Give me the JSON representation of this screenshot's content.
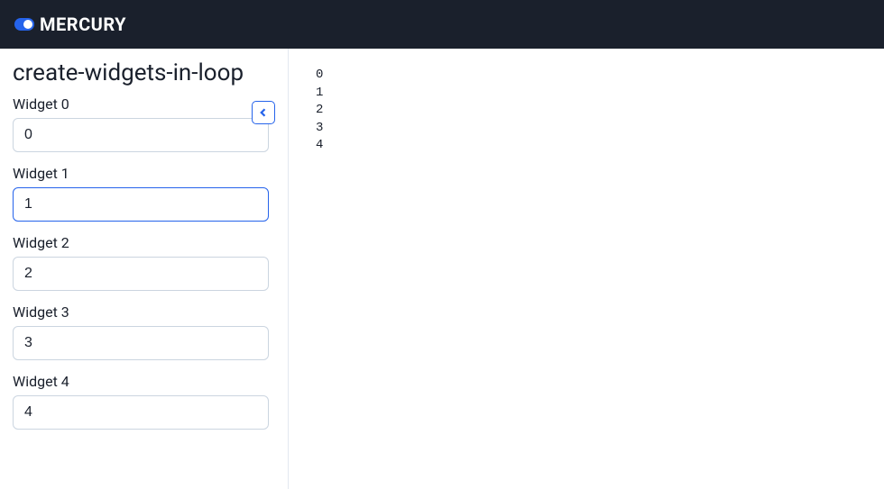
{
  "header": {
    "logo_text": "MERCURY"
  },
  "sidebar": {
    "title": "create-widgets-in-loop",
    "collapse_icon": "chevron-left",
    "focused_index": 1,
    "widgets": [
      {
        "label": "Widget 0",
        "value": "0"
      },
      {
        "label": "Widget 1",
        "value": "1"
      },
      {
        "label": "Widget 2",
        "value": "2"
      },
      {
        "label": "Widget 3",
        "value": "3"
      },
      {
        "label": "Widget 4",
        "value": "4"
      }
    ]
  },
  "output": {
    "lines": [
      "0",
      "1",
      "2",
      "3",
      "4"
    ]
  }
}
